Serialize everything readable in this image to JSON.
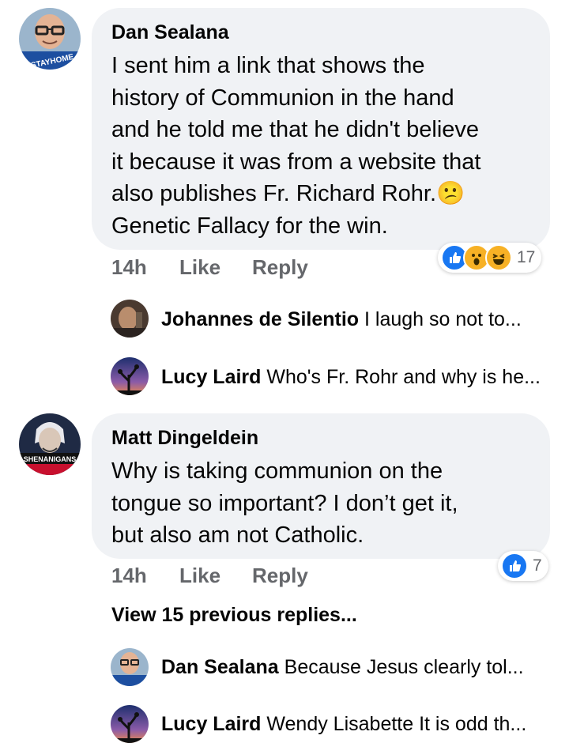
{
  "comments": [
    {
      "author": "Dan Sealana",
      "avatar_badge": "#STAYHOME",
      "lines": [
        "I sent him a link that shows the",
        "history of Communion in the hand",
        "and he told me that he didn't believe",
        "it because it was from a website that",
        "also publishes Fr. Richard Rohr.",
        "Genetic Fallacy for the win."
      ],
      "emoji": "😕",
      "time": "14h",
      "like_label": "Like",
      "reply_label": "Reply",
      "reaction_icons": [
        "like-icon",
        "wow-icon",
        "haha-icon"
      ],
      "reaction_count": "17",
      "replies": [
        {
          "name": "Johannes de Silentio",
          "text": "I laugh so not to..."
        },
        {
          "name": "Lucy Laird",
          "text": "Who's Fr. Rohr and why is he..."
        }
      ]
    },
    {
      "author": "Matt Dingeldein",
      "avatar_badge": "SHENANIGANS",
      "lines": [
        "Why is taking communion on the",
        "tongue so important?  I don’t get it,",
        "but also am not Catholic."
      ],
      "time": "14h",
      "like_label": "Like",
      "reply_label": "Reply",
      "reaction_icons": [
        "like-icon"
      ],
      "reaction_count": "7",
      "view_more": "View 15 previous replies...",
      "replies": [
        {
          "name": "Dan Sealana",
          "text": "Because Jesus clearly tol..."
        },
        {
          "name": "Lucy Laird",
          "text": "Wendy Lisabette It is odd th..."
        }
      ]
    }
  ],
  "colors": {
    "bubble": "#f0f2f5",
    "meta_text": "#65676b",
    "like_blue": "#1877f2",
    "emoji_yellow": "#f7b125"
  }
}
